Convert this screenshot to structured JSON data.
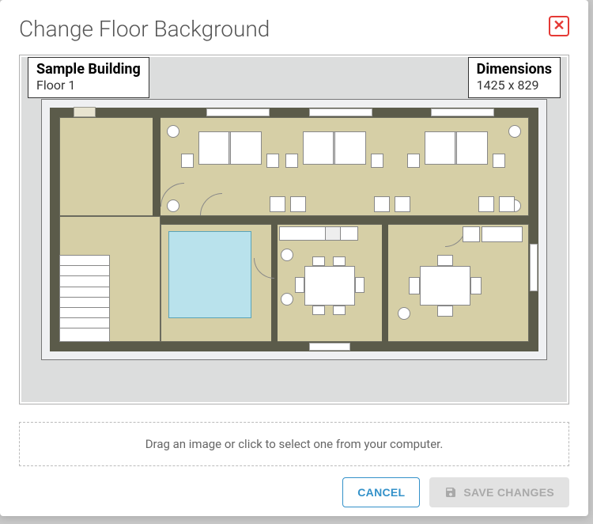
{
  "modal": {
    "title": "Change Floor Background"
  },
  "building_info": {
    "name": "Sample Building",
    "floor": "Floor 1"
  },
  "dimensions": {
    "label": "Dimensions",
    "value": "1425 x 829"
  },
  "dropzone": {
    "text": "Drag an image or click to select one from your computer."
  },
  "actions": {
    "cancel": "CANCEL",
    "save": "SAVE CHANGES"
  }
}
